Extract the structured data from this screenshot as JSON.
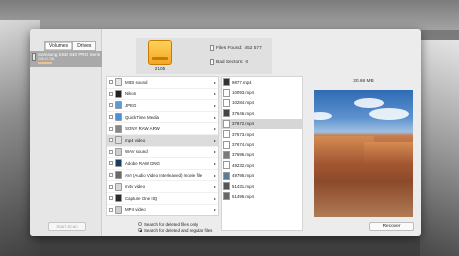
{
  "window": {
    "tabs": [
      {
        "label": "Volumes",
        "active": true
      },
      {
        "label": "Drives",
        "active": false
      }
    ],
    "volume": {
      "name": "Samsung SSD 840 PRO Series",
      "detail": "238.47 GB"
    },
    "start_button": "Start Scan"
  },
  "summary": {
    "drive_number": "2105",
    "files_found_label": "Files Found:",
    "files_found_value": "452 577",
    "bad_sectors_label": "Bad Sectors:",
    "bad_sectors_value": "0"
  },
  "types": [
    {
      "label": "MIDI sound",
      "color": "#e7e7e7"
    },
    {
      "label": "Nikon",
      "color": "#222222"
    },
    {
      "label": "JPEG",
      "color": "#5b9bd5"
    },
    {
      "label": "QuickTime Media",
      "color": "#4a90e2"
    },
    {
      "label": "SONY RAW ARW",
      "color": "#888888"
    },
    {
      "label": "mp4 video",
      "color": "#dddddd",
      "selected": true
    },
    {
      "label": "WAV sound",
      "color": "#cfcfcf"
    },
    {
      "label": "Adobe RAW DNG",
      "color": "#1d3a5f"
    },
    {
      "label": "AVI (Audio Video Interleaved) movie file",
      "color": "#6a6a6a"
    },
    {
      "label": "m4v video",
      "color": "#d9d9d9"
    },
    {
      "label": "Capture One IIQ",
      "color": "#2a2a2a"
    },
    {
      "label": "MP4 video",
      "color": "#cfcfcf"
    }
  ],
  "files": [
    {
      "label": "9877.mp4",
      "thumb": "#333333"
    },
    {
      "label": "10093.mp4",
      "thumb": "#ffffff"
    },
    {
      "label": "10284.mp4",
      "thumb": "#ffffff"
    },
    {
      "label": "37646.mp4",
      "thumb": "#444444"
    },
    {
      "label": "37672.mp4",
      "thumb": "#ffffff",
      "selected": true
    },
    {
      "label": "37673.mp4",
      "thumb": "#ffffff"
    },
    {
      "label": "37674.mp4",
      "thumb": "#ffffff"
    },
    {
      "label": "37696.mp4",
      "thumb": "#7a7a7a"
    },
    {
      "label": "49232.mp4",
      "thumb": "#ffffff"
    },
    {
      "label": "49795.mp4",
      "thumb": "#5a7a9a"
    },
    {
      "label": "51431.mp4",
      "thumb": "#555555"
    },
    {
      "label": "51496.mp4",
      "thumb": "#666666"
    }
  ],
  "preview": {
    "size": "20.66 MB"
  },
  "options": [
    {
      "label": "Search for deleted files only",
      "checked": false
    },
    {
      "label": "Search for deleted and regular files",
      "checked": true
    }
  ],
  "recover_button": "Recover",
  "colors": {
    "drive_yellow": "#f5a623",
    "selection_gray": "#d6d6d6"
  }
}
